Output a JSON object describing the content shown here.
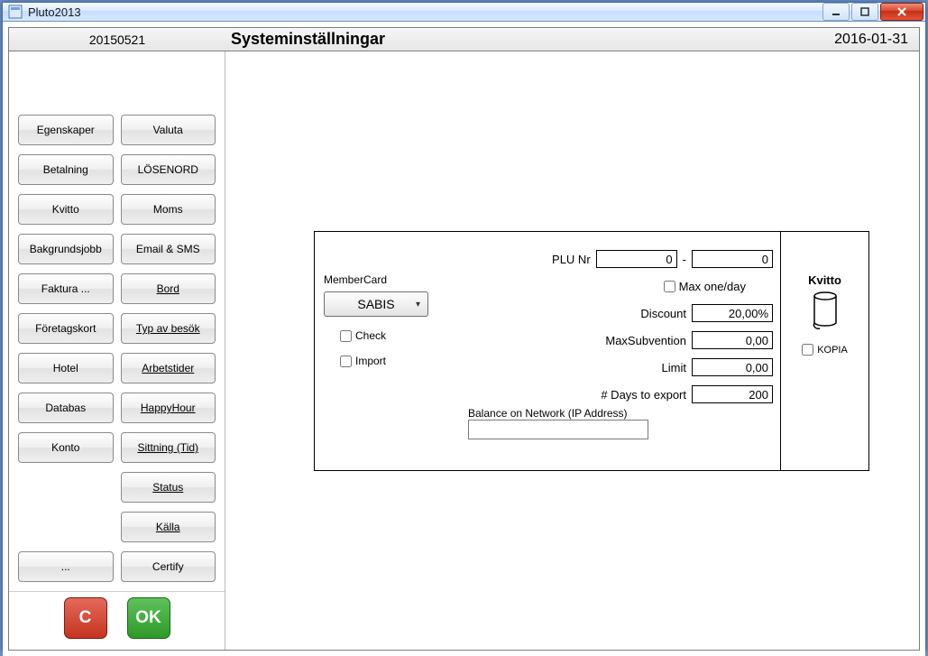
{
  "titlebar": {
    "app_name": "Pluto2013"
  },
  "header": {
    "date_code": "20150521",
    "page_title": "Systeminställningar",
    "system_date": "2016-01-31"
  },
  "sidebar": {
    "buttons": {
      "egenskaper": "Egenskaper",
      "valuta": "Valuta",
      "betalning": "Betalning",
      "losenord": "LÖSENORD",
      "kvitto": "Kvitto",
      "moms": "Moms",
      "bakgrundsjobb": "Bakgrundsjobb",
      "email_sms": "Email & SMS",
      "faktura": "Faktura ...",
      "bord": "Bord",
      "foretagskort": "Företagskort",
      "typ_av_besok": "Typ av besök",
      "hotel": "Hotel",
      "arbetstider": "Arbetstider",
      "databas": "Databas",
      "happyhour": "HappyHour",
      "konto": "Konto",
      "sittning": "Sittning (Tid)",
      "status": "Status",
      "kalla": "Källa",
      "dots": "...",
      "certify": "Certify"
    },
    "cancel_label": "C",
    "ok_label": "OK"
  },
  "form": {
    "membercard_label": "MemberCard",
    "membercard_value": "SABIS",
    "check_label": "Check",
    "import_label": "Import",
    "plu_label": "PLU Nr",
    "plu_from": "0",
    "plu_to": "0",
    "max_one_day_label": "Max one/day",
    "discount_label": "Discount",
    "discount_value": "20,00%",
    "maxsub_label": "MaxSubvention",
    "maxsub_value": "0,00",
    "limit_label": "Limit",
    "limit_value": "0,00",
    "days_export_label": "# Days to export",
    "days_export_value": "200",
    "balance_label": "Balance on Network",
    "ip_label": "(IP Address)",
    "ip_value": "",
    "kvitto_title": "Kvitto",
    "kopia_label": "KOPIA"
  }
}
